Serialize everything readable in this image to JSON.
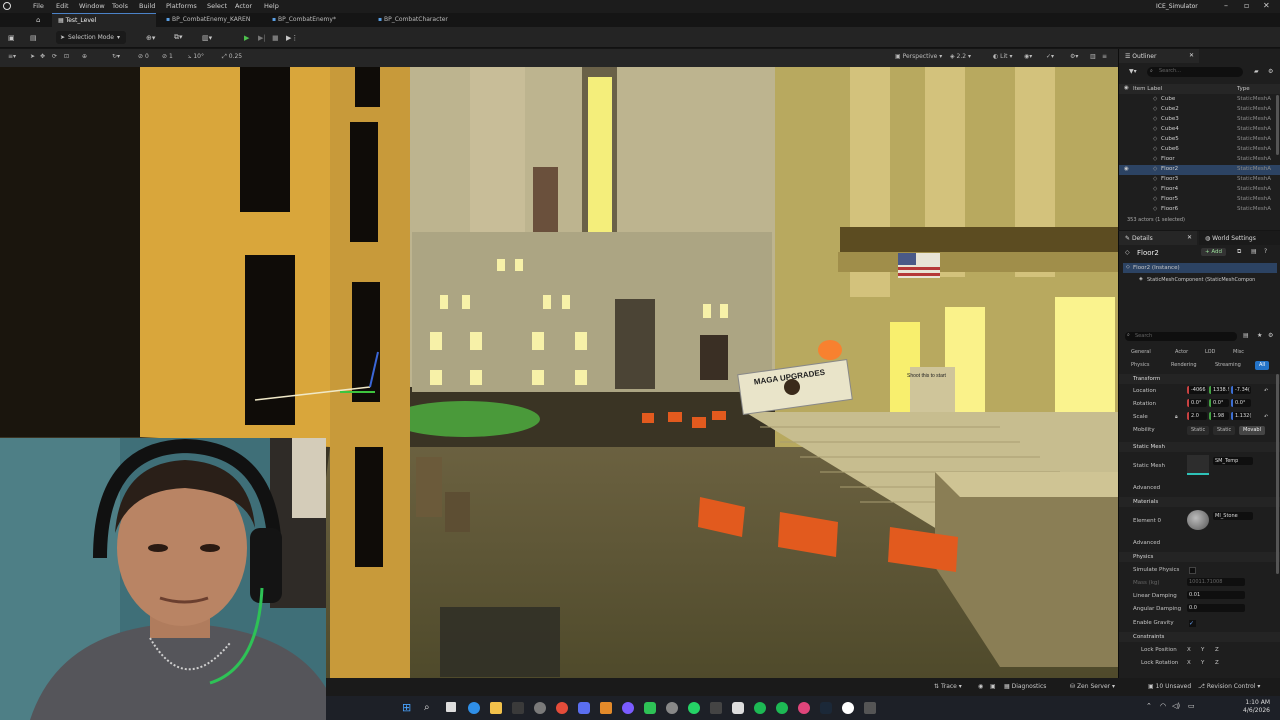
{
  "menu": {
    "items": [
      "File",
      "Edit",
      "Window",
      "Tools",
      "Build",
      "Platforms",
      "Select",
      "Actor",
      "Help"
    ],
    "app_title": "ICE_Simulator"
  },
  "tabs": [
    {
      "label": "Test_Level",
      "active": true
    },
    {
      "label": "BP_CombatEnemy_KAREN",
      "active": false
    },
    {
      "label": "BP_CombatEnemy*",
      "active": false
    },
    {
      "label": "BP_CombatCharacter",
      "active": false
    }
  ],
  "toolbar": {
    "selection_mode": "Selection Mode"
  },
  "viewport_toolbar": {
    "snap_translate": "10",
    "snap_rotate": "10°",
    "snap_scale": "0.25",
    "camera_speed_a": "0",
    "camera_speed_b": "1",
    "view_mode": "Perspective",
    "lit": "Lit",
    "fov_value": "2.2"
  },
  "viewport_scene": {
    "sign_text": "MAGA UPGRADES",
    "sign_small": "Shoot this to start"
  },
  "outliner": {
    "tab_label": "Outliner",
    "search_placeholder": "Search...",
    "col_label": "Item Label",
    "col_type": "Type",
    "rows": [
      {
        "label": "Cube",
        "type": "StaticMeshA"
      },
      {
        "label": "Cube2",
        "type": "StaticMeshA"
      },
      {
        "label": "Cube3",
        "type": "StaticMeshA"
      },
      {
        "label": "Cube4",
        "type": "StaticMeshA"
      },
      {
        "label": "Cube5",
        "type": "StaticMeshA"
      },
      {
        "label": "Cube6",
        "type": "StaticMeshA"
      },
      {
        "label": "Floor",
        "type": "StaticMeshA"
      },
      {
        "label": "Floor2",
        "type": "StaticMeshA",
        "selected": true
      },
      {
        "label": "Floor3",
        "type": "StaticMeshA"
      },
      {
        "label": "Floor4",
        "type": "StaticMeshA"
      },
      {
        "label": "Floor5",
        "type": "StaticMeshA"
      },
      {
        "label": "Floor6",
        "type": "StaticMeshA"
      }
    ],
    "status": "353 actors (1 selected)"
  },
  "details": {
    "tab_label": "Details",
    "world_settings_label": "World Settings",
    "actor_name": "Floor2",
    "add_label": "+ Add",
    "instance_label": "Floor2 (Instance)",
    "component_label": "StaticMeshComponent (StaticMeshCompon",
    "search_placeholder": "Search",
    "categories_row1": [
      "General",
      "Actor",
      "LOD",
      "Misc"
    ],
    "categories_row2": [
      "Physics",
      "Rendering",
      "Streaming",
      "All"
    ],
    "transform_header": "Transform",
    "location_label": "Location",
    "location_values": [
      "-4066",
      "1338.!",
      "-7.34("
    ],
    "rotation_label": "Rotation",
    "rotation_values": [
      "0.0°",
      "0.0°",
      "0.0°"
    ],
    "scale_label": "Scale",
    "scale_values": [
      "2.0",
      "1.98",
      "1.132("
    ],
    "mobility_label": "Mobility",
    "mobility_options": [
      "Static",
      "Static",
      "Movabl"
    ],
    "static_mesh_header": "Static Mesh",
    "static_mesh_label": "Static Mesh",
    "static_mesh_value": "SM_Temp",
    "advanced_label": "Advanced",
    "materials_header": "Materials",
    "element0_label": "Element 0",
    "element0_value": "MI_Stone",
    "advanced_label2": "Advanced",
    "physics_header": "Physics",
    "simulate_physics": "Simulate Physics",
    "mass_label": "Mass (kg)",
    "mass_value": "10011.71008",
    "linear_damping_label": "Linear Damping",
    "linear_damping_value": "0.01",
    "angular_damping_label": "Angular Damping",
    "angular_damping_value": "0.0",
    "enable_gravity_label": "Enable Gravity",
    "constraints_header": "Constraints",
    "lock_position_label": "Lock Position",
    "lock_rotation_label": "Lock Rotation",
    "axes": [
      "X",
      "Y",
      "Z"
    ]
  },
  "statusbar": {
    "trace": "Trace",
    "diagnostics": "Diagnostics",
    "zen_server": "Zen Server",
    "unsaved": "10 Unsaved",
    "revision_control": "Revision Control"
  },
  "taskbar": {
    "time": "1:10 AM",
    "date": "4/6/2026"
  }
}
